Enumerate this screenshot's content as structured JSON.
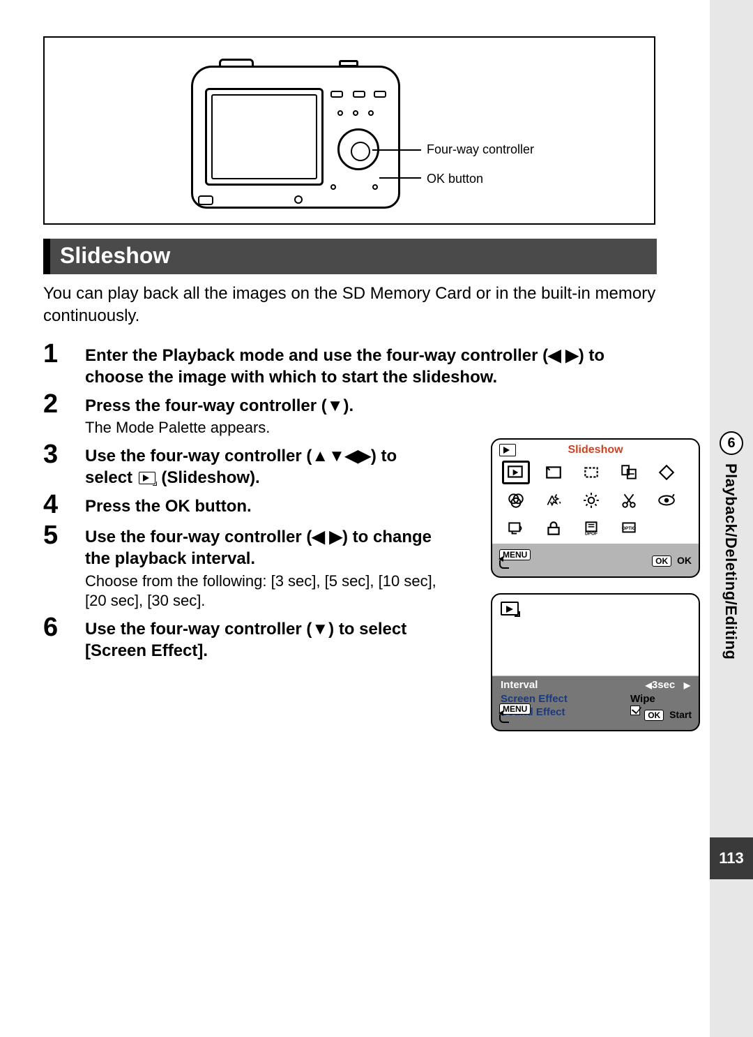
{
  "diagram": {
    "label_fourway": "Four-way controller",
    "label_ok": "OK button"
  },
  "section_heading": "Slideshow",
  "intro": "You can play back all the images on the SD Memory Card or in the built-in memory continuously.",
  "steps": {
    "s1": {
      "num": "1",
      "title_a": "Enter the Playback mode and use the four-way controller (",
      "title_arrows": "◀ ▶",
      "title_b": ") to choose the image with which to start the slideshow."
    },
    "s2": {
      "num": "2",
      "title_a": "Press the four-way controller (",
      "title_arrow": "▼",
      "title_b": ").",
      "desc": "The Mode Palette appears."
    },
    "s3": {
      "num": "3",
      "title_a": "Use the four-way controller (",
      "title_arrows": "▲▼◀▶",
      "title_b": ") to select ",
      "title_c": " (Slideshow)."
    },
    "s4": {
      "num": "4",
      "title": "Press the OK button."
    },
    "s5": {
      "num": "5",
      "title_a": "Use the four-way controller (",
      "title_arrows": "◀ ▶",
      "title_b": ") to change the playback interval.",
      "desc": "Choose from the following: [3 sec], [5 sec], [10 sec], [20 sec], [30 sec]."
    },
    "s6": {
      "num": "6",
      "title_a": "Use the four-way controller (",
      "title_arrow": "▼",
      "title_b": ") to select [Screen Effect]."
    }
  },
  "lcd1": {
    "title": "Slideshow",
    "menu": "MENU",
    "ok_btn": "OK",
    "ok_label": "OK"
  },
  "lcd2": {
    "rows": {
      "interval": {
        "label": "Interval",
        "value": "3sec"
      },
      "screen_effect": {
        "label": "Screen Effect",
        "value": "Wipe"
      },
      "sound_effect": {
        "label": "Sound Effect"
      }
    },
    "menu": "MENU",
    "ok_btn": "OK",
    "start": "Start"
  },
  "side": {
    "chapter_num": "6",
    "chapter_title": "Playback/Deleting/Editing",
    "page_num": "113"
  }
}
